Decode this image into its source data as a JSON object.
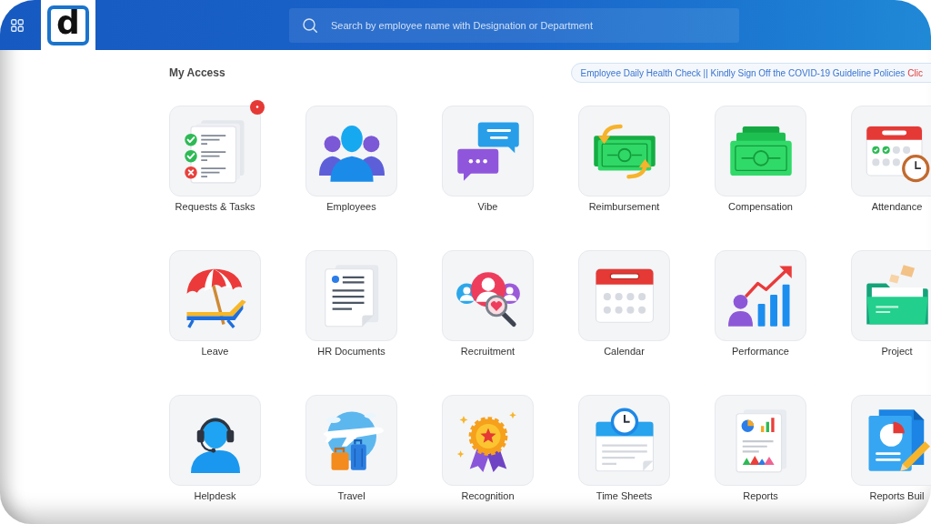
{
  "header": {
    "logo": "d",
    "search": {
      "placeholder": "Search by employee name with Designation or Department"
    }
  },
  "section": {
    "title": "My Access"
  },
  "announcement": {
    "text": "Employee Daily Health Check || Kindly Sign Off the COVID-19 Guideline Policies",
    "link": "Clic"
  },
  "apps": [
    {
      "label": "Requests & Tasks",
      "kind": "checklist",
      "notification": true
    },
    {
      "label": "Employees",
      "kind": "people",
      "notification": false
    },
    {
      "label": "Vibe",
      "kind": "chat",
      "notification": false
    },
    {
      "label": "Reimbursement",
      "kind": "exchange",
      "notification": false
    },
    {
      "label": "Compensation",
      "kind": "cash",
      "notification": false
    },
    {
      "label": "Attendance",
      "kind": "attendance",
      "notification": false
    },
    {
      "label": "Leave",
      "kind": "beach",
      "notification": false
    },
    {
      "label": "HR Documents",
      "kind": "document",
      "notification": false
    },
    {
      "label": "Recruitment",
      "kind": "recruit",
      "notification": false
    },
    {
      "label": "Calendar",
      "kind": "calendar",
      "notification": false
    },
    {
      "label": "Performance",
      "kind": "growth",
      "notification": false
    },
    {
      "label": "Project",
      "kind": "folder",
      "notification": false
    },
    {
      "label": "Helpdesk",
      "kind": "headset",
      "notification": false
    },
    {
      "label": "Travel",
      "kind": "travel",
      "notification": false
    },
    {
      "label": "Recognition",
      "kind": "award",
      "notification": false
    },
    {
      "label": "Time Sheets",
      "kind": "timesheet",
      "notification": false
    },
    {
      "label": "Reports",
      "kind": "report",
      "notification": false
    },
    {
      "label": "Reports Buil",
      "kind": "builder",
      "notification": false
    }
  ]
}
